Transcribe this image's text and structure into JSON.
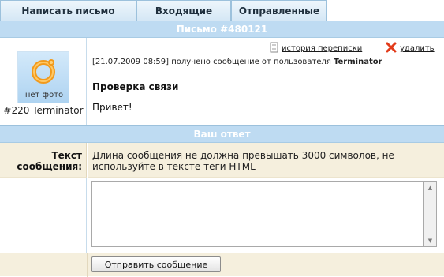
{
  "tabs": {
    "compose": "Написать письмо",
    "inbox": "Входящие",
    "sent": "Отправленные"
  },
  "letter": {
    "header": "Письмо #480121",
    "avatar_caption": "нет фото",
    "sender": "#220 Terminator",
    "history_link": "история переписки",
    "delete_link": "удалить",
    "meta_prefix": "[21.07.2009 08:59] получено сообщение от пользователя ",
    "meta_user": "Terminator",
    "subject": "Проверка связи",
    "body": "Привет!"
  },
  "reply": {
    "header": "Ваш ответ",
    "label": "Текст сообщения:",
    "hint": "Длина сообщения не должна превышать 3000 символов, не используйте в тексте теги HTML",
    "text_value": "",
    "submit_label": "Отправить сообщение"
  },
  "icons": {
    "history": "document-icon",
    "delete": "red-x-icon",
    "avatar": "no-photo-ring-icon"
  },
  "colors": {
    "bar": "#bedbf2",
    "tab": "#d5e7f5",
    "form_bg": "#f5efdd",
    "delete_icon": "#e23b1a",
    "avatar_ring": "#f29a1c"
  }
}
